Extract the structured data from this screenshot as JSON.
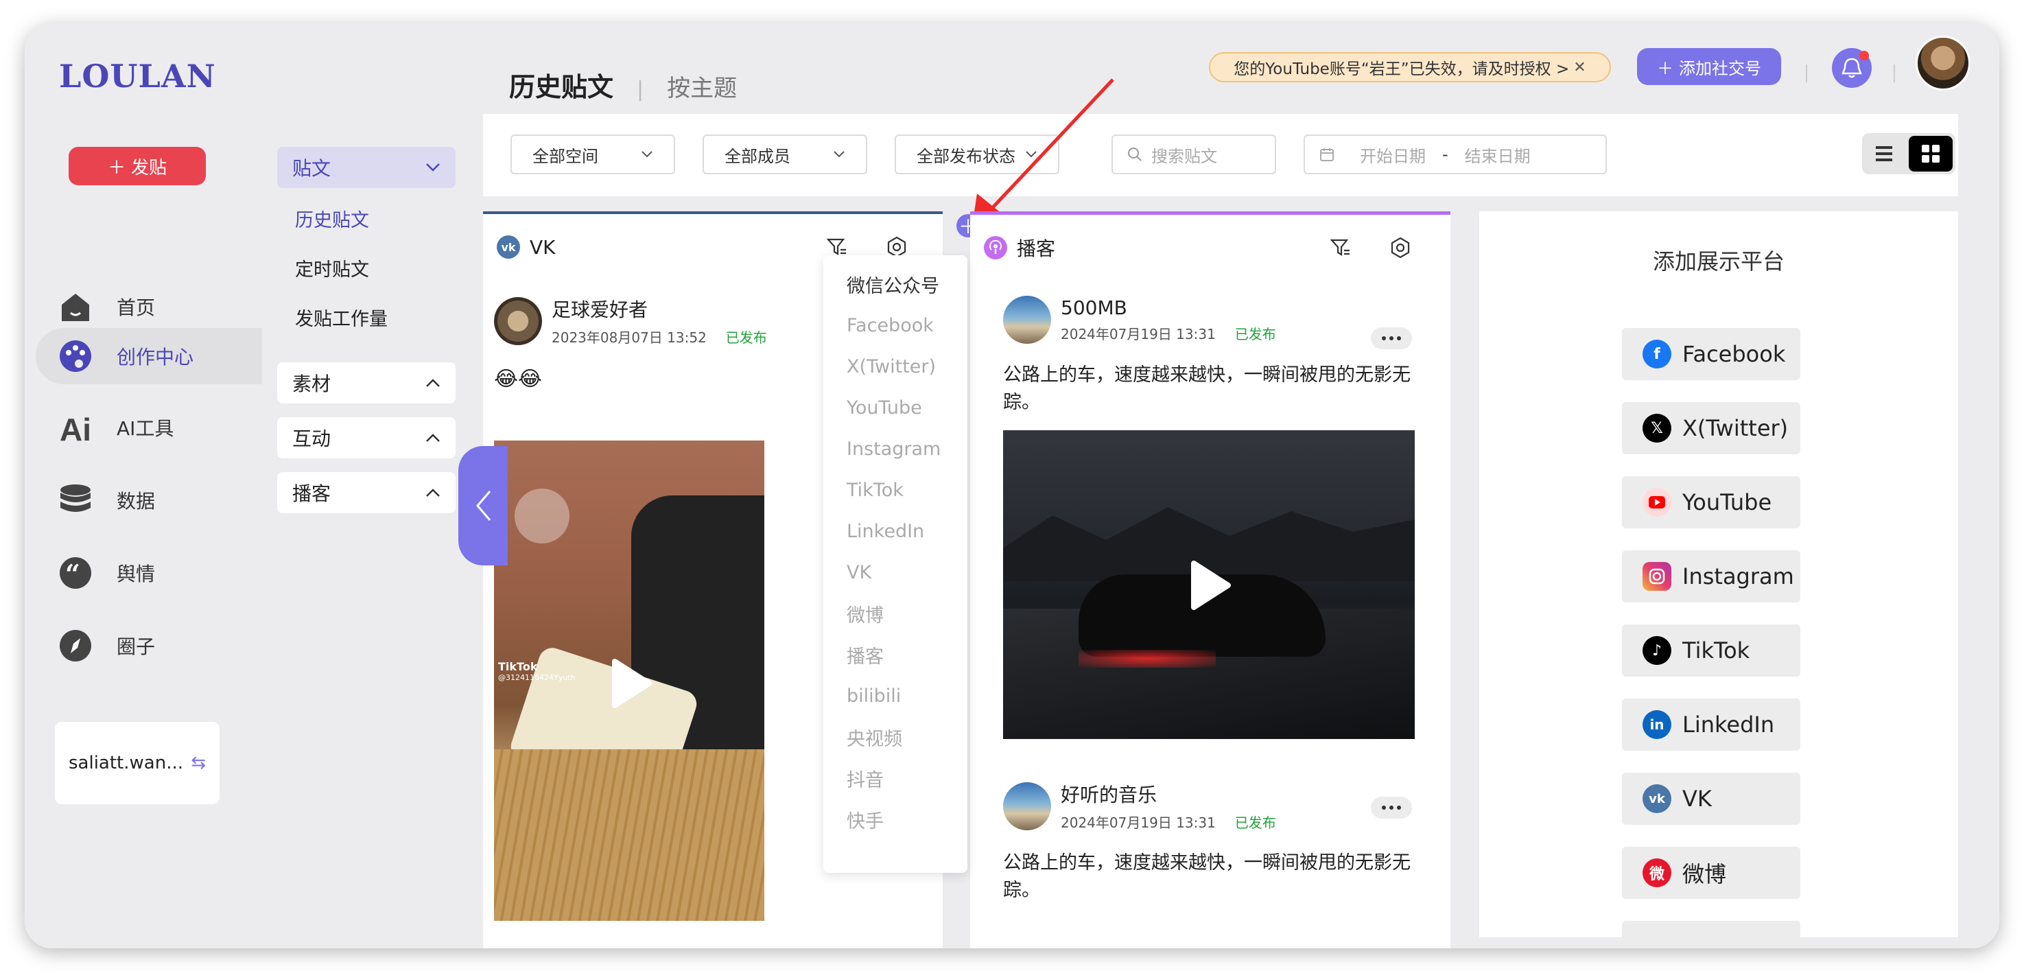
{
  "app": {
    "logo": "LOULAN",
    "post_button": "发贴"
  },
  "nav": [
    {
      "label": "首页",
      "icon": "home-icon"
    },
    {
      "label": "创作中心",
      "icon": "palette-icon"
    },
    {
      "label": "AI工具",
      "icon": "ai-icon"
    },
    {
      "label": "数据",
      "icon": "database-icon"
    },
    {
      "label": "舆情",
      "icon": "quote-icon"
    },
    {
      "label": "圈子",
      "icon": "compass-icon"
    }
  ],
  "user": {
    "name": "saliatt.wan..."
  },
  "subnav": {
    "posts_label": "贴文",
    "items": [
      "历史贴文",
      "定时贴文",
      "发贴工作量"
    ],
    "materials": "素材",
    "interaction": "互动",
    "podcast": "播客"
  },
  "header": {
    "tab_active": "历史贴文",
    "tab_other": "按主题",
    "notice": "您的YouTube账号“岩王”已失效，请及时授权 >",
    "add_account": "添加社交号"
  },
  "filters": {
    "space": "全部空间",
    "members": "全部成员",
    "status": "全部发布状态",
    "search_placeholder": "搜索贴文",
    "start_date": "开始日期",
    "date_sep": "-",
    "end_date": "结束日期"
  },
  "columns": {
    "vk": {
      "title": "VK",
      "post": {
        "author": "足球爱好者",
        "date": "2023年08月07日 13:52",
        "status": "已发布",
        "text": "😂😂",
        "video_label": "TikTok",
        "video_sub": "@3124116424Yyuth"
      }
    },
    "podcast": {
      "title": "播客",
      "posts": [
        {
          "author": "500MB",
          "date": "2024年07月19日 13:31",
          "status": "已发布",
          "text": "公路上的车，速度越来越快，一瞬间被甩的无影无踪。"
        },
        {
          "author": "好听的音乐",
          "date": "2024年07月19日 13:31",
          "status": "已发布",
          "text": "公路上的车，速度越来越快，一瞬间被甩的无影无踪。"
        }
      ]
    }
  },
  "dropdown": [
    "微信公众号",
    "Facebook",
    "X(Twitter)",
    "YouTube",
    "Instagram",
    "TikTok",
    "LinkedIn",
    "VK",
    "微博",
    "播客",
    "bilibili",
    "央视频",
    "抖音",
    "快手"
  ],
  "platforms": {
    "title": "添加展示平台",
    "items": [
      {
        "label": "Facebook",
        "icon": "facebook-icon",
        "color": "#1877f2"
      },
      {
        "label": "X(Twitter)",
        "icon": "x-icon",
        "color": "#000000"
      },
      {
        "label": "YouTube",
        "icon": "youtube-icon",
        "color": "#ff0000"
      },
      {
        "label": "Instagram",
        "icon": "instagram-icon",
        "color": "#d6249f"
      },
      {
        "label": "TikTok",
        "icon": "tiktok-icon",
        "color": "#000000"
      },
      {
        "label": "LinkedIn",
        "icon": "linkedin-icon",
        "color": "#0a66c2"
      },
      {
        "label": "VK",
        "icon": "vk-icon",
        "color": "#4a76a8"
      },
      {
        "label": "微博",
        "icon": "weibo-icon",
        "color": "#e6162d"
      }
    ]
  },
  "colors": {
    "accent": "#7b73e8",
    "brand": "#4b46b8",
    "danger": "#e8434f",
    "published": "#22a33a"
  }
}
